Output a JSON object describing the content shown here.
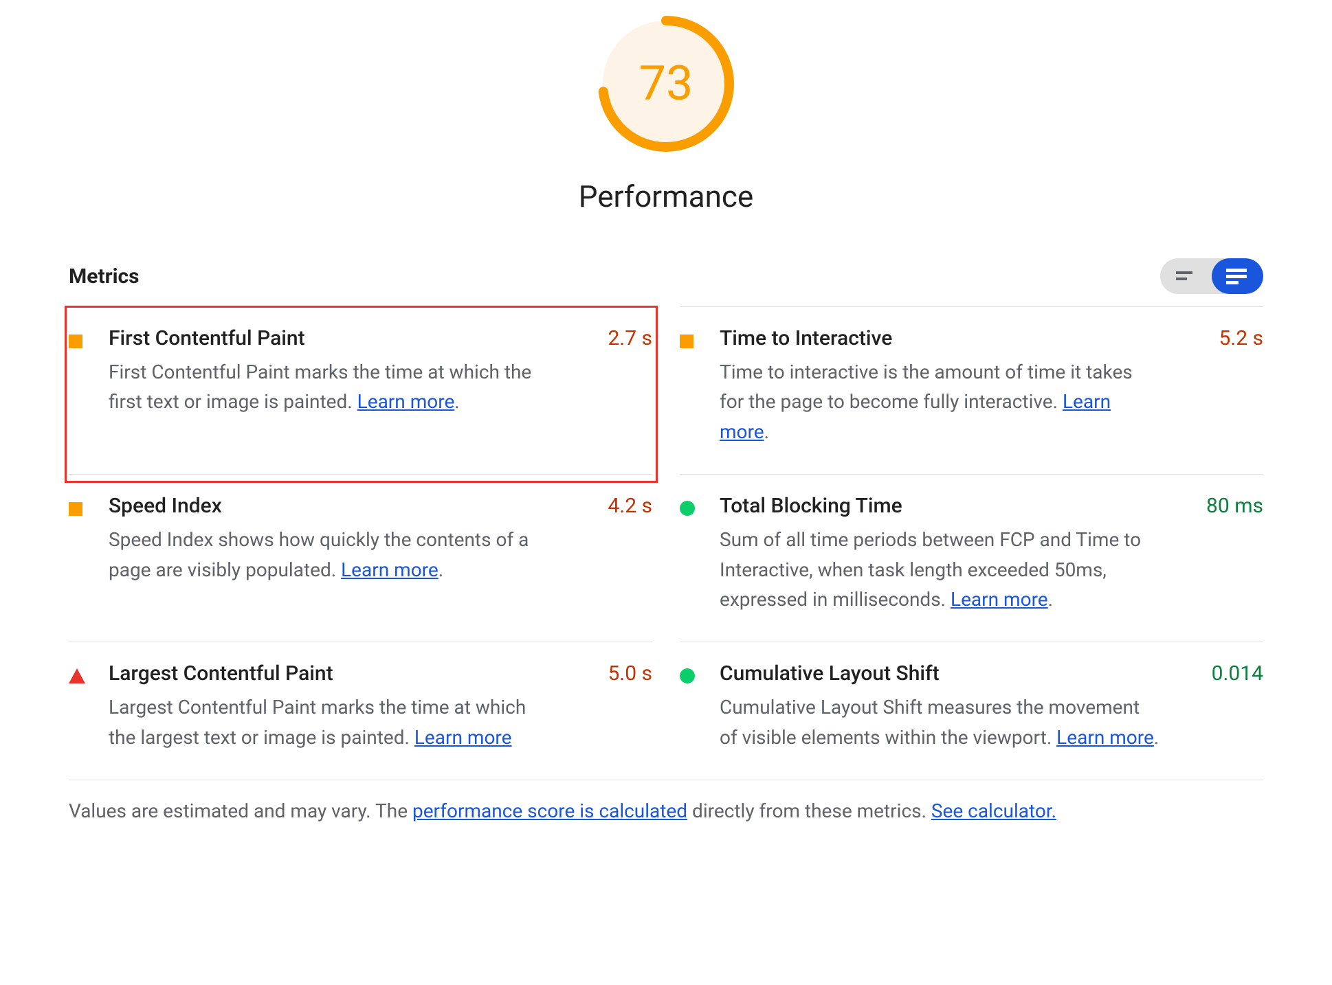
{
  "gauge": {
    "score": "73",
    "percent": 73,
    "label": "Performance",
    "color": "#fa9e00"
  },
  "metrics_header": "Metrics",
  "view_toggle": {
    "compact_active": false,
    "expanded_active": true
  },
  "metrics": [
    {
      "status": "warn",
      "title": "First Contentful Paint",
      "desc": "First Contentful Paint marks the time at which the first text or image is painted. ",
      "learn_more": "Learn more",
      "trailing_period": ".",
      "value": "2.7 s",
      "value_class": "value-orange",
      "highlighted": true
    },
    {
      "status": "warn",
      "title": "Time to Interactive",
      "desc": "Time to interactive is the amount of time it takes for the page to become fully interactive. ",
      "learn_more": "Learn more",
      "trailing_period": ".",
      "value": "5.2 s",
      "value_class": "value-orange",
      "highlighted": false
    },
    {
      "status": "warn",
      "title": "Speed Index",
      "desc": "Speed Index shows how quickly the contents of a page are visibly populated. ",
      "learn_more": "Learn more",
      "trailing_period": ".",
      "value": "4.2 s",
      "value_class": "value-orange",
      "highlighted": false
    },
    {
      "status": "good",
      "title": "Total Blocking Time",
      "desc": "Sum of all time periods between FCP and Time to Interactive, when task length exceeded 50ms, expressed in milliseconds. ",
      "learn_more": "Learn more",
      "trailing_period": ".",
      "value": "80 ms",
      "value_class": "value-green",
      "highlighted": false
    },
    {
      "status": "bad",
      "title": "Largest Contentful Paint",
      "desc": "Largest Contentful Paint marks the time at which the largest text or image is painted. ",
      "learn_more": "Learn more",
      "trailing_period": "",
      "value": "5.0 s",
      "value_class": "value-red",
      "highlighted": false
    },
    {
      "status": "good",
      "title": "Cumulative Layout Shift",
      "desc": "Cumulative Layout Shift measures the movement of visible elements within the viewport. ",
      "learn_more": "Learn more",
      "trailing_period": ".",
      "value": "0.014",
      "value_class": "value-green",
      "highlighted": false
    }
  ],
  "footer": {
    "pre": "Values are estimated and may vary. The ",
    "link1": "performance score is calculated",
    "mid": " directly from these metrics. ",
    "link2": "See calculator."
  }
}
